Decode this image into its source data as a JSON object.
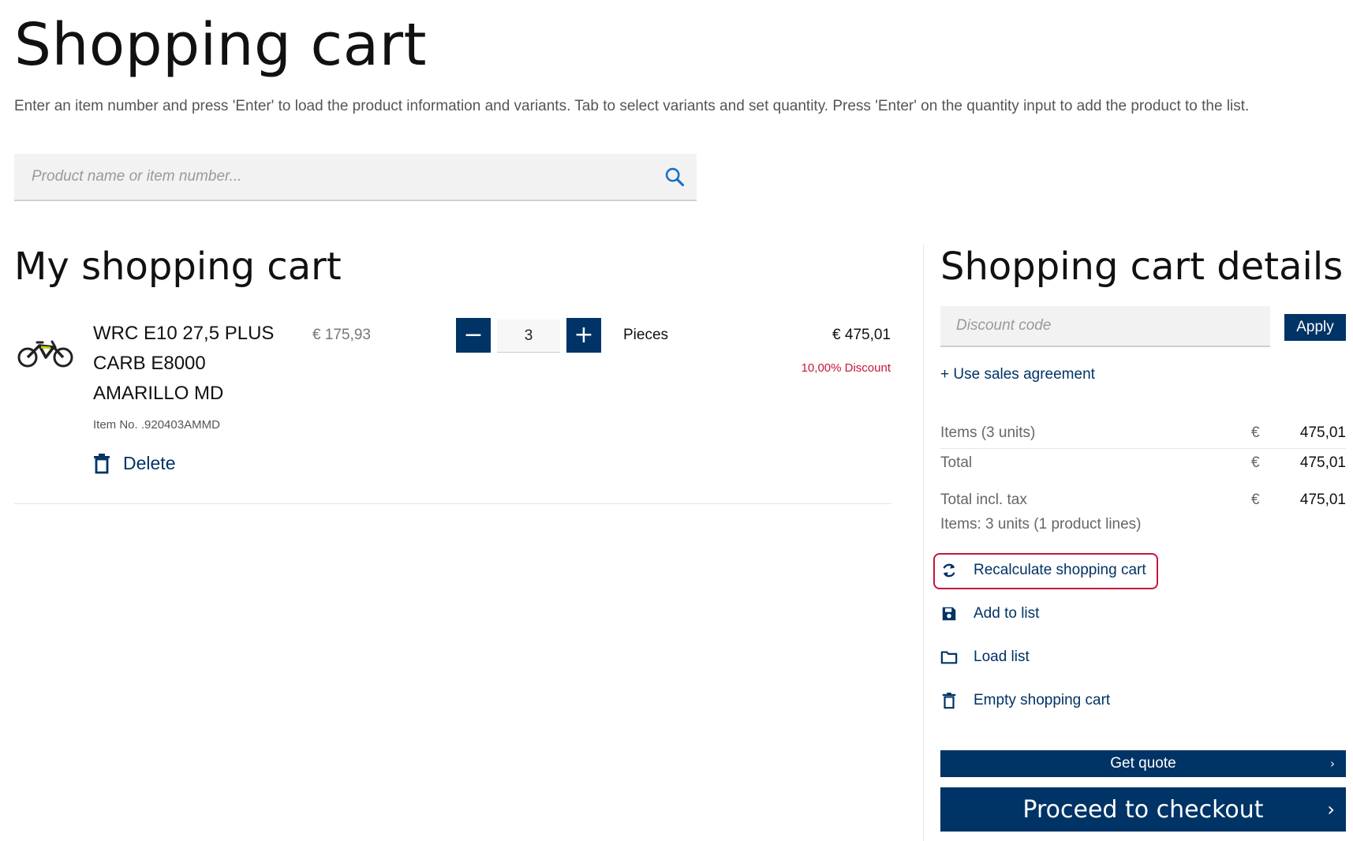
{
  "page": {
    "title": "Shopping cart",
    "instructions": "Enter an item number and press 'Enter' to load the product information and variants. Tab to select variants and set quantity. Press 'Enter' on the quantity input to add the product to the list."
  },
  "search": {
    "placeholder": "Product name or item number...",
    "icon": "search-icon"
  },
  "cart": {
    "title": "My shopping cart",
    "items": [
      {
        "name": "WRC E10 27,5 PLUS CARB E8000 AMARILLO MD",
        "item_no": "Item No. .920403AMMD",
        "unit_price": "€ 175,93",
        "quantity": "3",
        "unit": "Pieces",
        "line_total": "€ 475,01",
        "discount": "10,00%  Discount",
        "delete_label": "Delete",
        "minus_label": "−",
        "plus_label": "+"
      }
    ]
  },
  "details": {
    "title": "Shopping cart details",
    "discount_placeholder": "Discount code",
    "apply_label": "Apply",
    "sales_agreement": "+ Use sales agreement",
    "summary": [
      {
        "label": "Items (3 units)",
        "currency": "€",
        "value": "475,01"
      },
      {
        "label": "Total",
        "currency": "€",
        "value": "475,01"
      },
      {
        "label": "Total incl. tax",
        "currency": "€",
        "value": "475,01"
      }
    ],
    "units_summary": "Items: 3 units (1 product lines)",
    "actions": [
      {
        "label": "Recalculate shopping cart",
        "icon": "refresh-icon"
      },
      {
        "label": "Add to list",
        "icon": "save-icon"
      },
      {
        "label": "Load list",
        "icon": "folder-icon"
      },
      {
        "label": "Empty shopping cart",
        "icon": "trash-icon"
      }
    ],
    "get_quote": "Get quote",
    "checkout": "Proceed to checkout",
    "chevron": "›"
  },
  "colors": {
    "primary": "#003366",
    "accent": "#c4163c"
  }
}
